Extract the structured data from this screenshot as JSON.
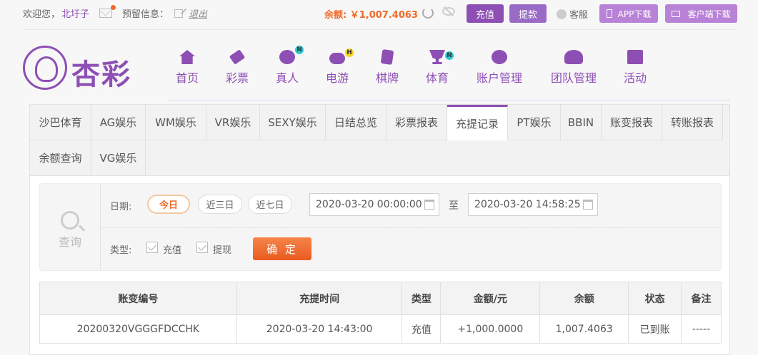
{
  "topbar": {
    "welcome": "欢迎您，",
    "username": "北圩子",
    "reserved_info_label": "预留信息：",
    "logout": "退出",
    "balance_text": "余额: ￥1,007.4063",
    "recharge": "充值",
    "withdraw": "提款",
    "customer_service": "客服",
    "app_download": "APP下载",
    "client_download": "客户端下载",
    "notification_color": "#f06a2a"
  },
  "logo": {
    "text": "杏彩"
  },
  "nav": [
    {
      "label": "首页",
      "icon": "home-icon",
      "badge": ""
    },
    {
      "label": "彩票",
      "icon": "lottery-ticket-icon",
      "badge": ""
    },
    {
      "label": "真人",
      "icon": "live-dealer-icon",
      "badge": "N"
    },
    {
      "label": "电游",
      "icon": "gamepad-icon",
      "badge": "H"
    },
    {
      "label": "棋牌",
      "icon": "cards-icon",
      "badge": ""
    },
    {
      "label": "体育",
      "icon": "trophy-icon",
      "badge": "N"
    },
    {
      "label": "账户管理",
      "icon": "account-coin-icon",
      "badge": ""
    },
    {
      "label": "团队管理",
      "icon": "team-icon",
      "badge": ""
    },
    {
      "label": "活动",
      "icon": "gift-icon",
      "badge": ""
    }
  ],
  "tabs": [
    "沙巴体育",
    "AG娱乐",
    "WM娱乐",
    "VR娱乐",
    "SEXY娱乐",
    "日结总览",
    "彩票报表",
    "充提记录",
    "PT娱乐",
    "BBIN",
    "账变报表",
    "转账报表",
    "余额查询",
    "VG娱乐"
  ],
  "active_tab": "充提记录",
  "filter": {
    "query_label": "查询",
    "date_label": "日期:",
    "quick_ranges": [
      "今日",
      "近三日",
      "近七日"
    ],
    "active_range": "今日",
    "start_date": "2020-03-20 00:00:00",
    "to_label": "至",
    "end_date": "2020-03-20 14:58:25",
    "type_label": "类型:",
    "types": [
      "充值",
      "提现"
    ],
    "confirm": "确 定"
  },
  "table": {
    "headers": [
      "账变编号",
      "充提时间",
      "类型",
      "金额/元",
      "余额",
      "状态",
      "备注"
    ],
    "rows": [
      [
        "20200320VGGGFDCCHK",
        "2020-03-20 14:43:00",
        "充值",
        "+1,000.0000",
        "1,007.4063",
        "已到账",
        "-----"
      ]
    ]
  },
  "colors": {
    "brand": "#8d4fb4",
    "accent": "#f06a2a",
    "amount": "#d42a2a",
    "status_ok": "#3da43d"
  }
}
